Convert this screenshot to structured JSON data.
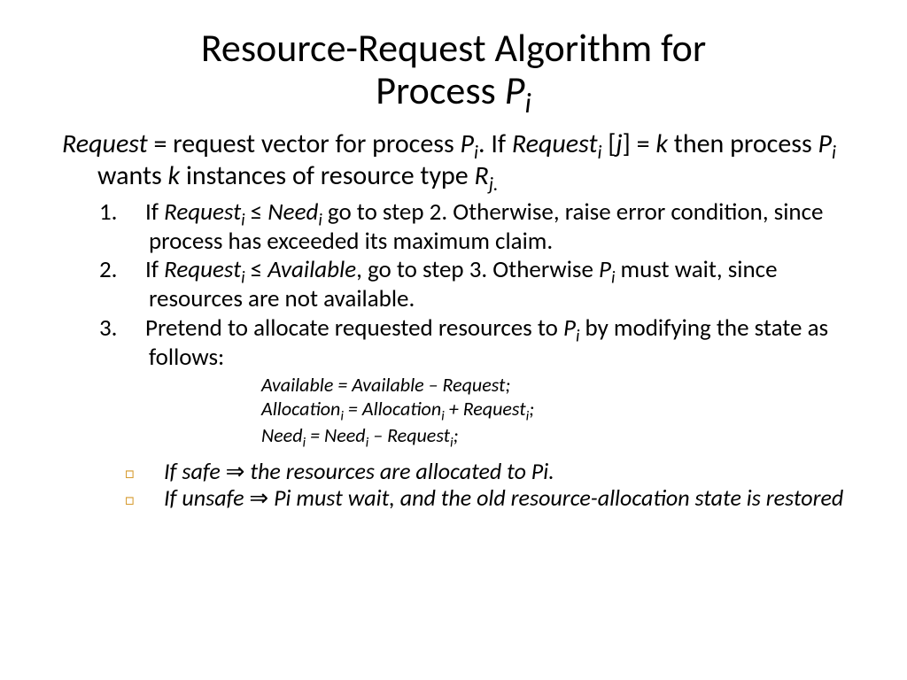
{
  "title": {
    "line1": "Resource-Request Algorithm for",
    "line2_a": "Process ",
    "line2_p": "P",
    "line2_sub": "i"
  },
  "intro": {
    "a": "Request",
    "b": " = request vector for process ",
    "c": "P",
    "csub": "i",
    "d": ".  If ",
    "e": "Request",
    "esub": "i",
    "f": " [",
    "g": "j",
    "h": "] = ",
    "i": "k",
    "j": " then process ",
    "k": "P",
    "ksub": "i",
    "l": " wants ",
    "m": "k",
    "n": " instances of resource type ",
    "o": "R",
    "osub": "j.",
    "p": ""
  },
  "step1": {
    "num": "1.",
    "a": "If ",
    "b": "Request",
    "bsub": "i",
    "c": " ≤ ",
    "d": "Need",
    "dsub": "i",
    "e": " go to step 2.  Otherwise, raise error condition, since process has exceeded its maximum claim."
  },
  "step2": {
    "num": "2.",
    "a": "If ",
    "b": "Request",
    "bsub": "i",
    "c": " ≤ ",
    "d": "Available",
    "e": ", go to step 3.  Otherwise ",
    "f": "P",
    "fsub": "i",
    "g": " must wait, since resources are not available."
  },
  "step3": {
    "num": "3.",
    "a": "Pretend to allocate requested resources to ",
    "b": "P",
    "bsub": "i",
    "c": " by modifying the state as follows:"
  },
  "formulas": {
    "l1": "Available = Available  – Request;",
    "l2a": "Allocation",
    "l2sub1": "i",
    "l2b": " = Allocation",
    "l2sub2": "i",
    "l2c": " + Request",
    "l2sub3": "i",
    "l2d": ";",
    "l3a": "Need",
    "l3sub1": "i",
    "l3b": " = Need",
    "l3sub2": "i",
    "l3c": " – Request",
    "l3sub3": "i",
    "l3d": ";"
  },
  "out1": {
    "a": "If safe ",
    "sym": "⇒",
    "b": " the resources are allocated to Pi."
  },
  "out2": {
    "a": "If unsafe ",
    "sym": "⇒",
    "b": " Pi must wait, and the old resource-allocation state is restored"
  }
}
